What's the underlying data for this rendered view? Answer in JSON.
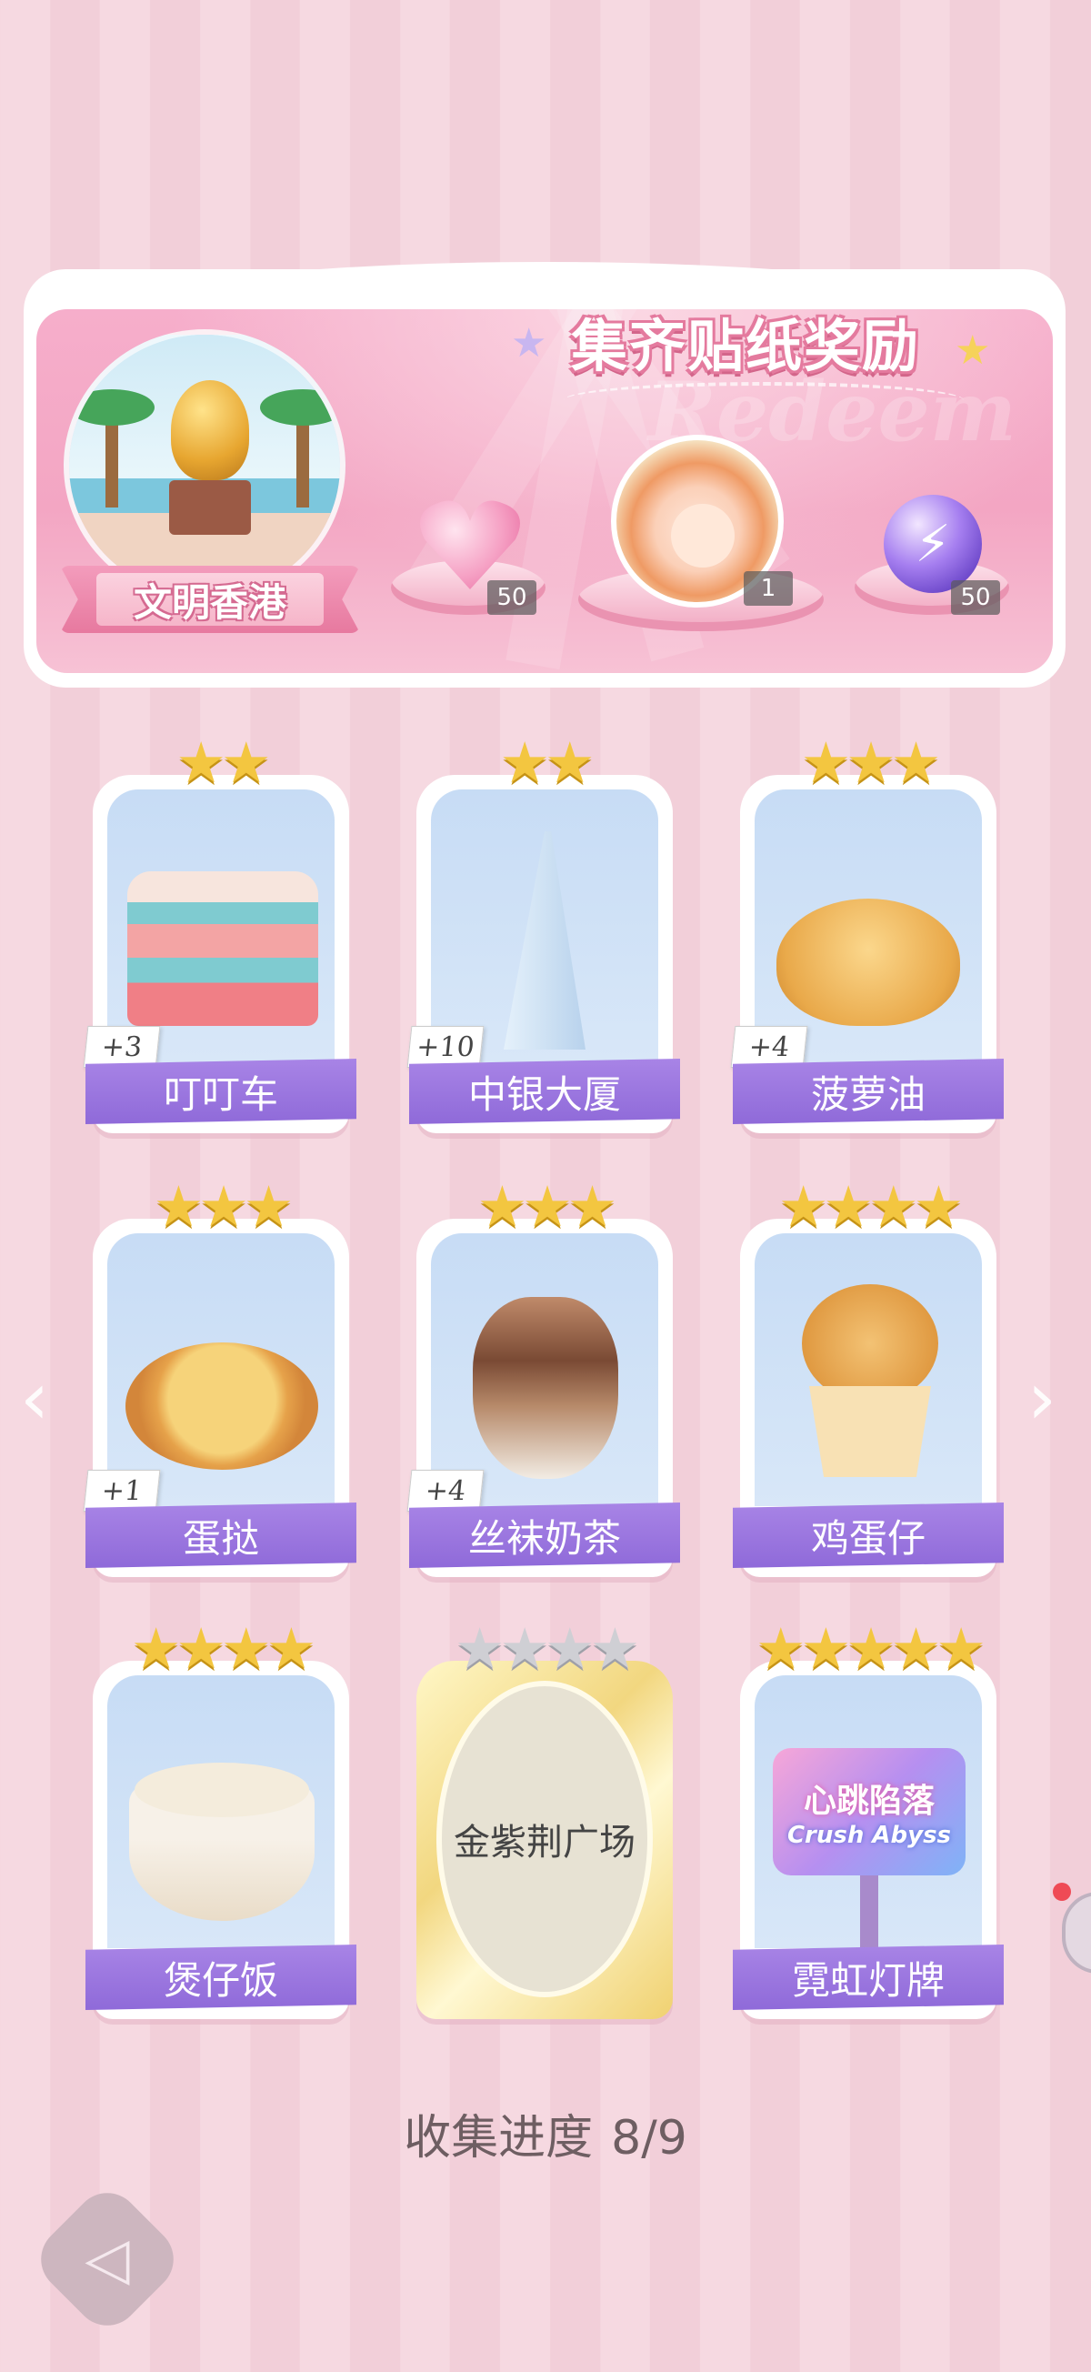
{
  "banner": {
    "title": "集齐贴纸奖励",
    "watermark": "Redeem",
    "location_label": "文明香港",
    "rewards": [
      {
        "icon": "pink-heart-gem-icon",
        "count": "50"
      },
      {
        "icon": "character-avatar-icon",
        "count": "1"
      },
      {
        "icon": "energy-orb-icon",
        "count": "50"
      }
    ]
  },
  "cards": [
    {
      "name": "叮叮车",
      "stars": 2,
      "max_stars": 2,
      "bonus": "+3",
      "art": "double-decker-tram"
    },
    {
      "name": "中银大厦",
      "stars": 2,
      "max_stars": 2,
      "bonus": "+10",
      "art": "bank-of-china-tower"
    },
    {
      "name": "菠萝油",
      "stars": 3,
      "max_stars": 3,
      "bonus": "+4",
      "art": "pineapple-bun"
    },
    {
      "name": "蛋挞",
      "stars": 3,
      "max_stars": 3,
      "bonus": "+1",
      "art": "egg-tart"
    },
    {
      "name": "丝袜奶茶",
      "stars": 3,
      "max_stars": 3,
      "bonus": "+4",
      "art": "milk-tea"
    },
    {
      "name": "鸡蛋仔",
      "stars": 4,
      "max_stars": 4,
      "bonus": "",
      "art": "egg-waffle"
    },
    {
      "name": "煲仔饭",
      "stars": 4,
      "max_stars": 4,
      "bonus": "",
      "art": "claypot-rice"
    },
    {
      "name": "金紫荆广场",
      "stars": 0,
      "max_stars": 4,
      "bonus": "",
      "art": "locked"
    },
    {
      "name": "霓虹灯牌",
      "stars": 5,
      "max_stars": 5,
      "bonus": "",
      "art": "neon-sign"
    }
  ],
  "neon_sign": {
    "line1": "心跳陷落",
    "line2": "Crush Abyss"
  },
  "progress": {
    "label": "收集进度",
    "value": "8/9"
  },
  "nav": {
    "prev": "‹",
    "next": "›",
    "back": "◁"
  },
  "colors": {
    "label_purple": "#9b74de",
    "star_gold": "#f3c640",
    "star_off": "#cfcfd4",
    "card_bg": "#c7dcf5"
  }
}
